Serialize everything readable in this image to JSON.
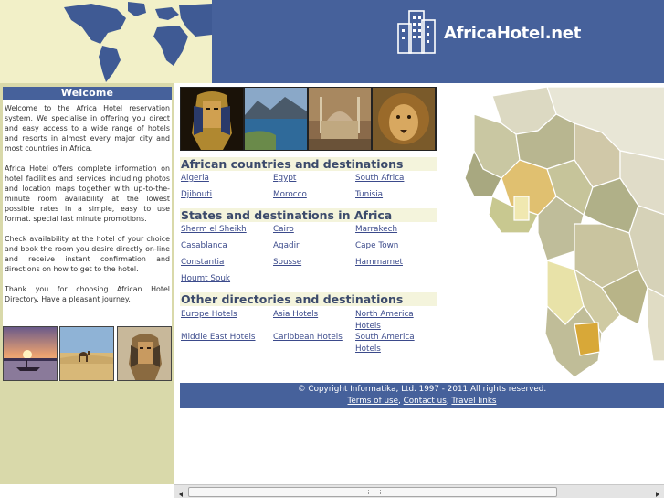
{
  "header": {
    "logo_text": "AfricaHotel.net"
  },
  "welcome": {
    "title": "Welcome",
    "paragraphs": [
      "Welcome to the Africa Hotel reservation system. We specialise in offering you direct and easy access to a wide range of hotels and resorts in almost every major city and most countries in Africa.",
      "Africa Hotel offers complete information on hotel facilities and services including photos and location maps together with up-to-the-minute room availability at the lowest possible rates in a simple, easy to use format. special last minute promotions.",
      "Check availability at the hotel of your choice and book the room you desire directly on-line and receive instant confirmation and directions on how to get to the hotel.",
      "Thank you for choosing African Hotel Directory. Have a pleasant journey."
    ]
  },
  "sections": {
    "countries": {
      "title": "African countries and destinations",
      "links": [
        "Algeria",
        "Egypt",
        "South Africa",
        "Djibouti",
        "Morocco",
        "Tunisia"
      ]
    },
    "states": {
      "title": "States and destinations in Africa",
      "links": [
        "Sherm el Sheikh",
        "Cairo",
        "Marrakech",
        "Casablanca",
        "Agadir",
        "Cape Town",
        "Constantia",
        "Sousse",
        "Hammamet",
        "Houmt Souk"
      ]
    },
    "other": {
      "title": "Other directories and destinations",
      "links": [
        "Europe Hotels",
        "Asia Hotels",
        "North America Hotels",
        "Middle East Hotels",
        "Caribbean Hotels",
        "South America Hotels"
      ]
    }
  },
  "footer": {
    "copyright": "© Copyright Informatika, Ltd. 1997 - 2011 All rights reserved.",
    "terms": "Terms of use",
    "contact": "Contact us",
    "travel": "Travel links",
    "sep": ","
  },
  "colors": {
    "header_blue": "#46619b",
    "sidebar_khaki": "#d9d9aa",
    "link_blue": "#3b4a8b"
  },
  "icons": [
    "hotel-building-icon",
    "scroll-left-arrow-icon",
    "scroll-right-arrow-icon"
  ]
}
